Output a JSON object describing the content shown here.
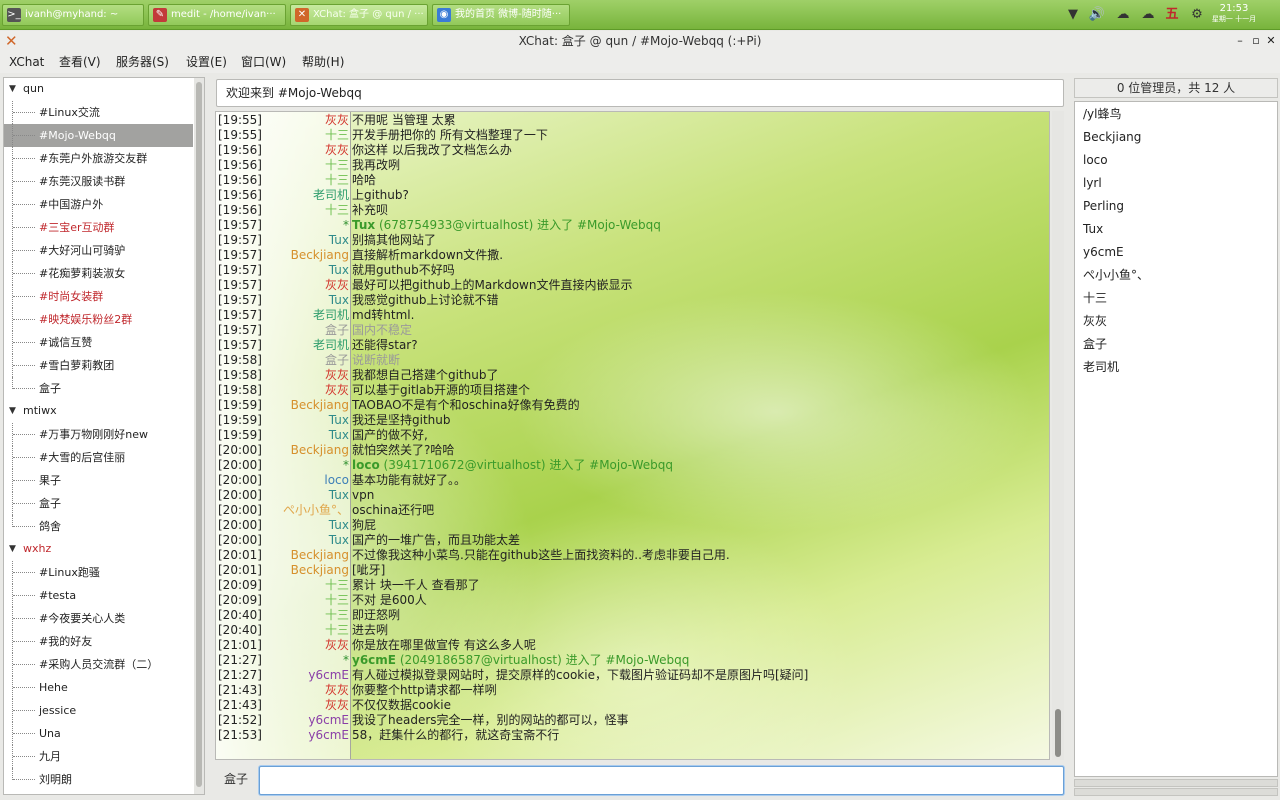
{
  "taskbar": {
    "tasks": [
      {
        "label": "ivanh@myhand: ~",
        "icon": ">_",
        "color": "#555"
      },
      {
        "label": "medit - /home/ivan···",
        "icon": "✎",
        "color": "#c23a3a"
      },
      {
        "label": "XChat: 盒子 @ qun / ···",
        "icon": "✕",
        "color": "#d0672a"
      },
      {
        "label": "我的首页 微博-随时随···",
        "icon": "◉",
        "color": "#3a7bd5"
      }
    ],
    "clock": {
      "time": "21:53",
      "date": "星期一 十一月"
    }
  },
  "window": {
    "title": "XChat: 盒子 @ qun / #Mojo-Webqq (:+Pi)"
  },
  "menu": [
    "XChat",
    "查看(V)",
    "服务器(S)",
    "设置(E)",
    "窗口(W)",
    "帮助(H)"
  ],
  "sidebar": {
    "servers": [
      {
        "name": "qun",
        "color": "#222",
        "channels": [
          {
            "name": "#Linux交流",
            "color": "#222"
          },
          {
            "name": "#Mojo-Webqq",
            "color": "#fff",
            "selected": true
          },
          {
            "name": "#东莞户外旅游交友群",
            "color": "#222"
          },
          {
            "name": "#东莞汉服读书群",
            "color": "#222"
          },
          {
            "name": "#中国游户外",
            "color": "#222"
          },
          {
            "name": "#三宝er互动群",
            "color": "#c0282d"
          },
          {
            "name": "#大好河山可骑驴",
            "color": "#222"
          },
          {
            "name": "#花痴萝莉装淑女",
            "color": "#222"
          },
          {
            "name": "#时尚女装群",
            "color": "#c0282d"
          },
          {
            "name": "#映梵娱乐粉丝2群",
            "color": "#c0282d"
          },
          {
            "name": "#诚信互赞",
            "color": "#222"
          },
          {
            "name": "#雪白萝莉教团",
            "color": "#222"
          },
          {
            "name": "盒子",
            "color": "#222"
          }
        ]
      },
      {
        "name": "mtiwx",
        "color": "#222",
        "channels": [
          {
            "name": "#万事万物刚刚好new",
            "color": "#222"
          },
          {
            "name": "#大雪的后宫佳丽",
            "color": "#222"
          },
          {
            "name": "果子",
            "color": "#222"
          },
          {
            "name": "盒子",
            "color": "#222"
          },
          {
            "name": "鸽舍",
            "color": "#222"
          }
        ]
      },
      {
        "name": "wxhz",
        "color": "#c0282d",
        "channels": [
          {
            "name": "#Linux跑骚",
            "color": "#222"
          },
          {
            "name": "#testa",
            "color": "#222"
          },
          {
            "name": "#今夜要关心人类",
            "color": "#222"
          },
          {
            "name": "#我的好友",
            "color": "#222"
          },
          {
            "name": "#采购人员交流群（二）",
            "color": "#222"
          },
          {
            "name": "Hehe",
            "color": "#222"
          },
          {
            "name": "jessice",
            "color": "#222"
          },
          {
            "name": "Una",
            "color": "#222"
          },
          {
            "name": "九月",
            "color": "#222"
          },
          {
            "name": "刘明朗",
            "color": "#222"
          }
        ]
      }
    ]
  },
  "topic": "欢迎来到 #Mojo-Webqq",
  "messages": [
    {
      "time": "[19:55]",
      "nick": "灰灰",
      "nick_color": "#d2352c",
      "text": "不用呢 当管理 太累"
    },
    {
      "time": "[19:55]",
      "nick": "十三",
      "nick_color": "#6fc050",
      "text": "开发手册把你的 所有文档整理了一下"
    },
    {
      "time": "[19:56]",
      "nick": "灰灰",
      "nick_color": "#d2352c",
      "text": "你这样 以后我改了文档怎么办"
    },
    {
      "time": "[19:56]",
      "nick": "十三",
      "nick_color": "#6fc050",
      "text": "我再改咧"
    },
    {
      "time": "[19:56]",
      "nick": "十三",
      "nick_color": "#6fc050",
      "text": " 哈哈"
    },
    {
      "time": "[19:56]",
      "nick": "老司机",
      "nick_color": "#2f9e6d",
      "text": "上github?"
    },
    {
      "time": "[19:56]",
      "nick": "十三",
      "nick_color": "#6fc050",
      "text": " 补充呗"
    },
    {
      "time": "[19:57]",
      "nick": "*",
      "nick_color": "#2e8f2e",
      "text": "Tux (678754933@virtualhost) 进入了 #Mojo-Webqq",
      "join": true,
      "jnick": "Tux"
    },
    {
      "time": "[19:57]",
      "nick": "Tux",
      "nick_color": "#2f8b8b",
      "text": "别搞其他网站了"
    },
    {
      "time": "[19:57]",
      "nick": "Beckjiang",
      "nick_color": "#d6902c",
      "text": "直接解析markdown文件撒."
    },
    {
      "time": "[19:57]",
      "nick": "Tux",
      "nick_color": "#2f8b8b",
      "text": "就用guthub不好吗"
    },
    {
      "time": "[19:57]",
      "nick": "灰灰",
      "nick_color": "#d2352c",
      "text": "最好可以把github上的Markdown文件直接内嵌显示"
    },
    {
      "time": "[19:57]",
      "nick": "Tux",
      "nick_color": "#2f8b8b",
      "text": "我感觉github上讨论就不错"
    },
    {
      "time": "[19:57]",
      "nick": "老司机",
      "nick_color": "#2f9e6d",
      "text": "md转html."
    },
    {
      "time": "[19:57]",
      "nick": "盒子",
      "nick_color": "#9a9a9a",
      "text": "国内不稳定",
      "self": true
    },
    {
      "time": "[19:57]",
      "nick": "老司机",
      "nick_color": "#2f9e6d",
      "text": "还能得star?"
    },
    {
      "time": "[19:58]",
      "nick": "盒子",
      "nick_color": "#9a9a9a",
      "text": "说断就断",
      "self": true
    },
    {
      "time": "[19:58]",
      "nick": "灰灰",
      "nick_color": "#d2352c",
      "text": "我都想自己搭建个github了"
    },
    {
      "time": "[19:58]",
      "nick": "灰灰",
      "nick_color": "#d2352c",
      "text": "可以基于gitlab开源的项目搭建个"
    },
    {
      "time": "[19:59]",
      "nick": "Beckjiang",
      "nick_color": "#d6902c",
      "text": "TAOBAO不是有个和oschina好像有免费的"
    },
    {
      "time": "[19:59]",
      "nick": "Tux",
      "nick_color": "#2f8b8b",
      "text": "我还是坚持github"
    },
    {
      "time": "[19:59]",
      "nick": "Tux",
      "nick_color": "#2f8b8b",
      "text": "国产的做不好,"
    },
    {
      "time": "[20:00]",
      "nick": "Beckjiang",
      "nick_color": "#d6902c",
      "text": "就怕突然关了?哈哈"
    },
    {
      "time": "[20:00]",
      "nick": "*",
      "nick_color": "#2e8f2e",
      "text": "loco (3941710672@virtualhost) 进入了 #Mojo-Webqq",
      "join": true,
      "jnick": "loco"
    },
    {
      "time": "[20:00]",
      "nick": "loco",
      "nick_color": "#3e7fb8",
      "text": "基本功能有就好了。。"
    },
    {
      "time": "[20:00]",
      "nick": "Tux",
      "nick_color": "#2f8b8b",
      "text": "vpn"
    },
    {
      "time": "[20:00]",
      "nick": "ぺ小小鱼°、",
      "nick_color": "#e0a64a",
      "text": "oschina还行吧"
    },
    {
      "time": "[20:00]",
      "nick": "Tux",
      "nick_color": "#2f8b8b",
      "text": "狗屁"
    },
    {
      "time": "[20:00]",
      "nick": "Tux",
      "nick_color": "#2f8b8b",
      "text": "国产的一堆广告，而且功能太差"
    },
    {
      "time": "[20:01]",
      "nick": "Beckjiang",
      "nick_color": "#d6902c",
      "text": "不过像我这种小菜鸟.只能在github这些上面找资料的..考虑非要自己用."
    },
    {
      "time": "[20:01]",
      "nick": "Beckjiang",
      "nick_color": "#d6902c",
      "text": "[呲牙]"
    },
    {
      "time": "[20:09]",
      "nick": "十三",
      "nick_color": "#6fc050",
      "text": "累计 块一千人 查看那了"
    },
    {
      "time": "[20:09]",
      "nick": "十三",
      "nick_color": "#6fc050",
      "text": "不对 是600人"
    },
    {
      "time": "[20:40]",
      "nick": "十三",
      "nick_color": "#6fc050",
      "text": "即迂怒咧"
    },
    {
      "time": "[20:40]",
      "nick": "十三",
      "nick_color": "#6fc050",
      "text": "进去咧"
    },
    {
      "time": "[21:01]",
      "nick": "灰灰",
      "nick_color": "#d2352c",
      "text": "你是放在哪里做宣传 有这么多人呢"
    },
    {
      "time": "[21:27]",
      "nick": "*",
      "nick_color": "#2e8f2e",
      "text": "y6cmE (2049186587@virtualhost) 进入了 #Mojo-Webqq",
      "join": true,
      "jnick": "y6cmE"
    },
    {
      "time": "[21:27]",
      "nick": "y6cmE",
      "nick_color": "#8a3fa8",
      "text": "有人碰过模拟登录网站时，提交原样的cookie，下载图片验证码却不是原图片吗[疑问]"
    },
    {
      "time": "[21:43]",
      "nick": "灰灰",
      "nick_color": "#d2352c",
      "text": "你要整个http请求都一样咧"
    },
    {
      "time": "[21:43]",
      "nick": "灰灰",
      "nick_color": "#d2352c",
      "text": "不仅仅数据cookie"
    },
    {
      "time": "[21:52]",
      "nick": "y6cmE",
      "nick_color": "#8a3fa8",
      "text": "我设了headers完全一样，别的网站的都可以，怪事"
    },
    {
      "time": "[21:53]",
      "nick": "y6cmE",
      "nick_color": "#8a3fa8",
      "text": "58，赶集什么的都行，就这奇宝斋不行"
    }
  ],
  "input": {
    "nick": "盒子",
    "value": ""
  },
  "userlist": {
    "header": "0 位管理员，共 12 人",
    "users": [
      "/yl蜂鸟",
      "Beckjiang",
      "loco",
      "lyrl",
      "Perling",
      "Tux",
      "y6cmE",
      "ぺ小小鱼°、",
      "十三",
      "灰灰",
      "盒子",
      "老司机"
    ]
  }
}
